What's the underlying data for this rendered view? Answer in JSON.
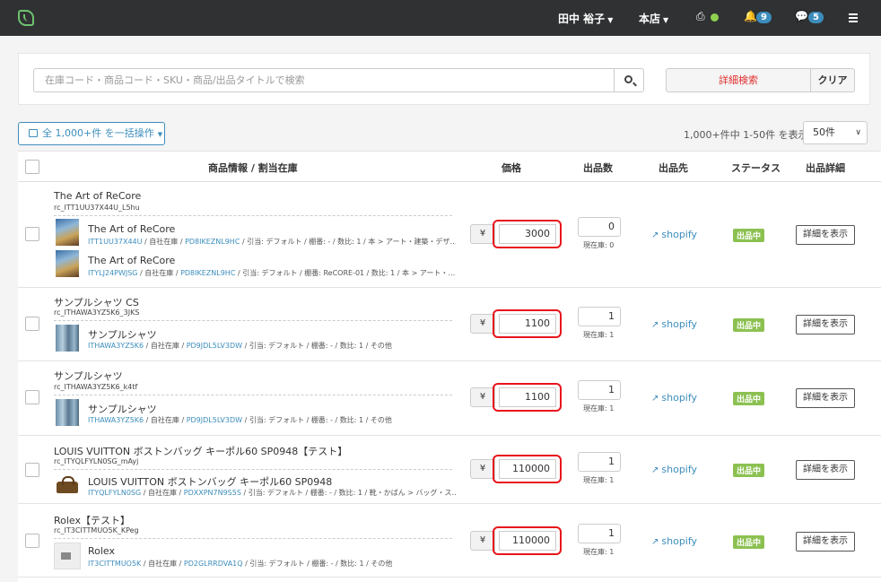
{
  "header": {
    "user_name": "田中 裕子",
    "store": "本店",
    "notifications": "9",
    "messages": "5",
    "printer_status_color": "#8fd14f"
  },
  "search": {
    "placeholder": "在庫コード・商品コード・SKU・商品/出品タイトルで検索",
    "advanced_label": "詳細検索",
    "clear_label": "クリア"
  },
  "toolbar": {
    "bulk_label": "全 1,000+件 を一括操作",
    "pager_info": "1,000+件中 1-50件 を表示",
    "page_size": "50件"
  },
  "table": {
    "headers": {
      "product": "商品情報 / 割当在庫",
      "price": "価格",
      "quantity": "出品数",
      "channel": "出品先",
      "status": "ステータス",
      "detail": "出品詳細"
    },
    "rows": [
      {
        "title": "The Art of ReCore",
        "code": "rc_ITT1UU37X44U_L5hu",
        "price": "3000",
        "quantity": "0",
        "stock": "現在庫: 0",
        "channel": "shopify",
        "status": "出品中",
        "detail_label": "詳細を表示",
        "items": [
          {
            "name": "The Art of ReCore",
            "code1": "ITT1UU37X44U",
            "code2": "PD8IKEZNL9HC",
            "meta1": " / 自社在庫 / ",
            "meta2": " / 引当: デフォルト / 棚番: - / 数比: 1 / 本 > アート・建築・デザ…"
          },
          {
            "name": "The Art of ReCore",
            "code1": "ITYLJ24PWJSG",
            "code2": "PD8IKEZNL9HC",
            "meta1": " / 自社在庫 / ",
            "meta2": " / 引当: デフォルト / 棚番: ReCORE-01 / 数比: 1 / 本 > アート・…"
          }
        ]
      },
      {
        "title": "サンプルシャツ CS",
        "code": "rc_ITHAWA3YZ5K6_3JKS",
        "price": "1100",
        "quantity": "1",
        "stock": "現在庫: 1",
        "channel": "shopify",
        "status": "出品中",
        "detail_label": "詳細を表示",
        "items": [
          {
            "name": "サンプルシャツ",
            "code1": "ITHAWA3YZ5K6",
            "code2": "PD9JDL5LV3DW",
            "meta1": " / 自社在庫 / ",
            "meta2": " / 引当: デフォルト / 棚番: - / 数比: 1 / その他"
          }
        ]
      },
      {
        "title": "サンプルシャツ",
        "code": "rc_ITHAWA3YZ5K6_k4tf",
        "price": "1100",
        "quantity": "1",
        "stock": "現在庫: 1",
        "channel": "shopify",
        "status": "出品中",
        "detail_label": "詳細を表示",
        "items": [
          {
            "name": "サンプルシャツ",
            "code1": "ITHAWA3YZ5K6",
            "code2": "PD9JDL5LV3DW",
            "meta1": " / 自社在庫 / ",
            "meta2": " / 引当: デフォルト / 棚番: - / 数比: 1 / その他"
          }
        ]
      },
      {
        "title": "LOUIS VUITTON ボストンバッグ キーポル60 SP0948【テスト】",
        "code": "rc_ITYQLFYLN0SG_mAyj",
        "price": "110000",
        "quantity": "1",
        "stock": "現在庫: 1",
        "channel": "shopify",
        "status": "出品中",
        "detail_label": "詳細を表示",
        "items": [
          {
            "name": "LOUIS VUITTON ボストンバッグ キーポル60 SP0948",
            "code1": "ITYQLFYLN0SG",
            "code2": "PDXXPN7N9S5S",
            "meta1": " / 自社在庫 / ",
            "meta2": " / 引当: デフォルト / 棚番: - / 数比: 1 / 靴・かばん > バッグ・ス…"
          }
        ]
      },
      {
        "title": "Rolex【テスト】",
        "code": "rc_IT3CITTMUO5K_KPeg",
        "price": "110000",
        "quantity": "1",
        "stock": "現在庫: 1",
        "channel": "shopify",
        "status": "出品中",
        "detail_label": "詳細を表示",
        "items": [
          {
            "name": "Rolex",
            "code1": "IT3CITTMUO5K",
            "code2": "PD2GLRRDVA1Q",
            "meta1": " / 自社在庫 / ",
            "meta2": " / 引当: デフォルト / 棚番: - / 数比: 1 / その他"
          }
        ]
      }
    ]
  },
  "colors": {
    "topbar": "#2f3133",
    "accent": "#3c8dbc",
    "status_green": "#8cc152",
    "highlight_red": "#e8141c"
  }
}
